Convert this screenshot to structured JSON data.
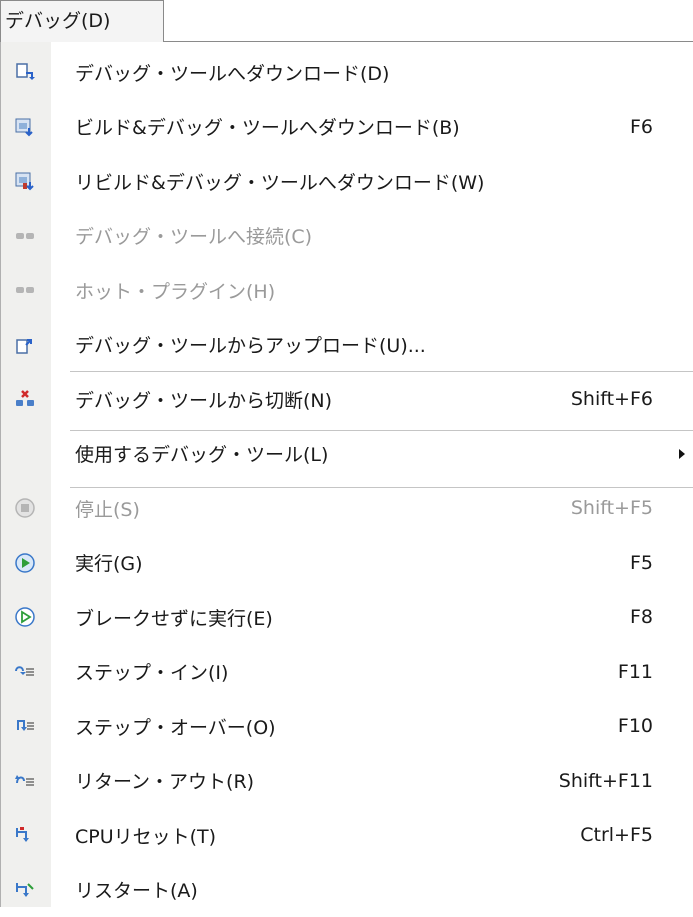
{
  "menubar": {
    "title": "デバッグ(D)"
  },
  "menu": {
    "items": [
      {
        "label": "デバッグ・ツールへダウンロード(D)",
        "shortcut": "",
        "icon": "download-to-tool-icon",
        "enabled": true
      },
      {
        "label": "ビルド&デバッグ・ツールへダウンロード(B)",
        "shortcut": "F6",
        "icon": "build-download-icon",
        "enabled": true
      },
      {
        "label": "リビルド&デバッグ・ツールへダウンロード(W)",
        "shortcut": "",
        "icon": "rebuild-download-icon",
        "enabled": true
      },
      {
        "label": "デバッグ・ツールへ接続(C)",
        "shortcut": "",
        "icon": "connect-icon",
        "enabled": false
      },
      {
        "label": "ホット・プラグイン(H)",
        "shortcut": "",
        "icon": "hot-plugin-icon",
        "enabled": false
      },
      {
        "label": "デバッグ・ツールからアップロード(U)...",
        "shortcut": "",
        "icon": "upload-icon",
        "enabled": true
      },
      {
        "label": "デバッグ・ツールから切断(N)",
        "shortcut": "Shift+F6",
        "icon": "disconnect-icon",
        "enabled": true
      },
      {
        "label": "使用するデバッグ・ツール(L)",
        "shortcut": "",
        "icon": "",
        "enabled": true,
        "submenu": true
      },
      {
        "label": "停止(S)",
        "shortcut": "Shift+F5",
        "icon": "stop-icon",
        "enabled": false
      },
      {
        "label": "実行(G)",
        "shortcut": "F5",
        "icon": "run-icon",
        "enabled": true
      },
      {
        "label": "ブレークせずに実行(E)",
        "shortcut": "F8",
        "icon": "run-no-break-icon",
        "enabled": true
      },
      {
        "label": "ステップ・イン(I)",
        "shortcut": "F11",
        "icon": "step-in-icon",
        "enabled": true
      },
      {
        "label": "ステップ・オーバー(O)",
        "shortcut": "F10",
        "icon": "step-over-icon",
        "enabled": true
      },
      {
        "label": "リターン・アウト(R)",
        "shortcut": "Shift+F11",
        "icon": "return-out-icon",
        "enabled": true
      },
      {
        "label": "CPUリセット(T)",
        "shortcut": "Ctrl+F5",
        "icon": "cpu-reset-icon",
        "enabled": true
      },
      {
        "label": "リスタート(A)",
        "shortcut": "",
        "icon": "restart-icon",
        "enabled": true
      }
    ]
  }
}
